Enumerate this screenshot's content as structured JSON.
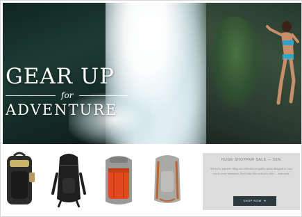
{
  "hero": {
    "headline_line1": "GEAR UP",
    "headline_for": "for",
    "headline_line2": "ADVENTURE"
  },
  "products": [
    {
      "name": "black-hydration-pack",
      "icon": "backpack-icon",
      "colors": {
        "main": "#2b2b2b",
        "accent": "#c8b46a"
      }
    },
    {
      "name": "black-technical-pack",
      "icon": "backpack-icon",
      "colors": {
        "main": "#1e1e1e",
        "accent": "#3a3a3a"
      }
    },
    {
      "name": "orange-grey-pack",
      "icon": "backpack-icon",
      "colors": {
        "main": "#e24a1d",
        "accent": "#9a9a98"
      }
    },
    {
      "name": "grey-rust-pack",
      "icon": "backpack-icon",
      "colors": {
        "main": "#a9a9a6",
        "accent": "#c0632b"
      }
    }
  ],
  "promo": {
    "title": "HUGE SHOPPER SALE — 50%",
    "body": "All styles, one sale. Shop our collection of quality packs designed to carry you to every adventure. Don't miss this exclusive offer — ends soon.",
    "button_label": "SHOP NOW",
    "button_arrow": "➔"
  },
  "colors": {
    "promo_bg": "#dcdcdc",
    "button_bg": "#2f3a40"
  }
}
